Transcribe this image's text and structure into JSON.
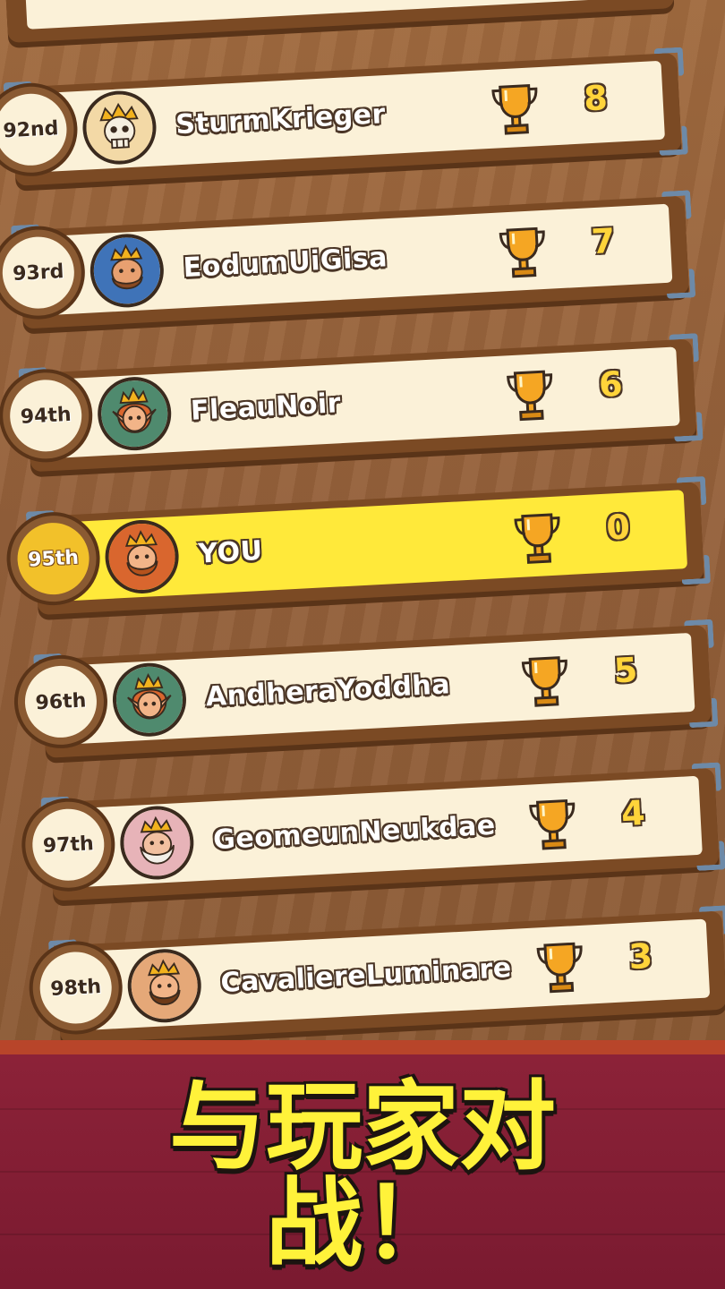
{
  "leaderboard": {
    "rows": [
      {
        "rank": "92nd",
        "name": "SturmKrieger",
        "score": "8",
        "avatar": "skeleton-king-icon"
      },
      {
        "rank": "93rd",
        "name": "EodumUiGisa",
        "score": "7",
        "avatar": "bald-king-icon"
      },
      {
        "rank": "94th",
        "name": "FleauNoir",
        "score": "6",
        "avatar": "elf-queen-icon"
      },
      {
        "rank": "95th",
        "name": "YOU",
        "score": "0",
        "avatar": "bearded-king-icon"
      },
      {
        "rank": "96th",
        "name": "AndheraYoddha",
        "score": "5",
        "avatar": "elf-queen-icon"
      },
      {
        "rank": "97th",
        "name": "GeomeunNeukdae",
        "score": "4",
        "avatar": "old-king-icon"
      },
      {
        "rank": "98th",
        "name": "CavaliereLuminare",
        "score": "3",
        "avatar": "brown-king-icon"
      }
    ]
  },
  "banner": {
    "line1": "与玩家对",
    "line2": "战！"
  },
  "colors": {
    "highlight": "#ffe93a",
    "panel": "#fbf1d8",
    "score": "#ffd43a",
    "banner": "#8c2238",
    "banner_text": "#fff23a"
  }
}
